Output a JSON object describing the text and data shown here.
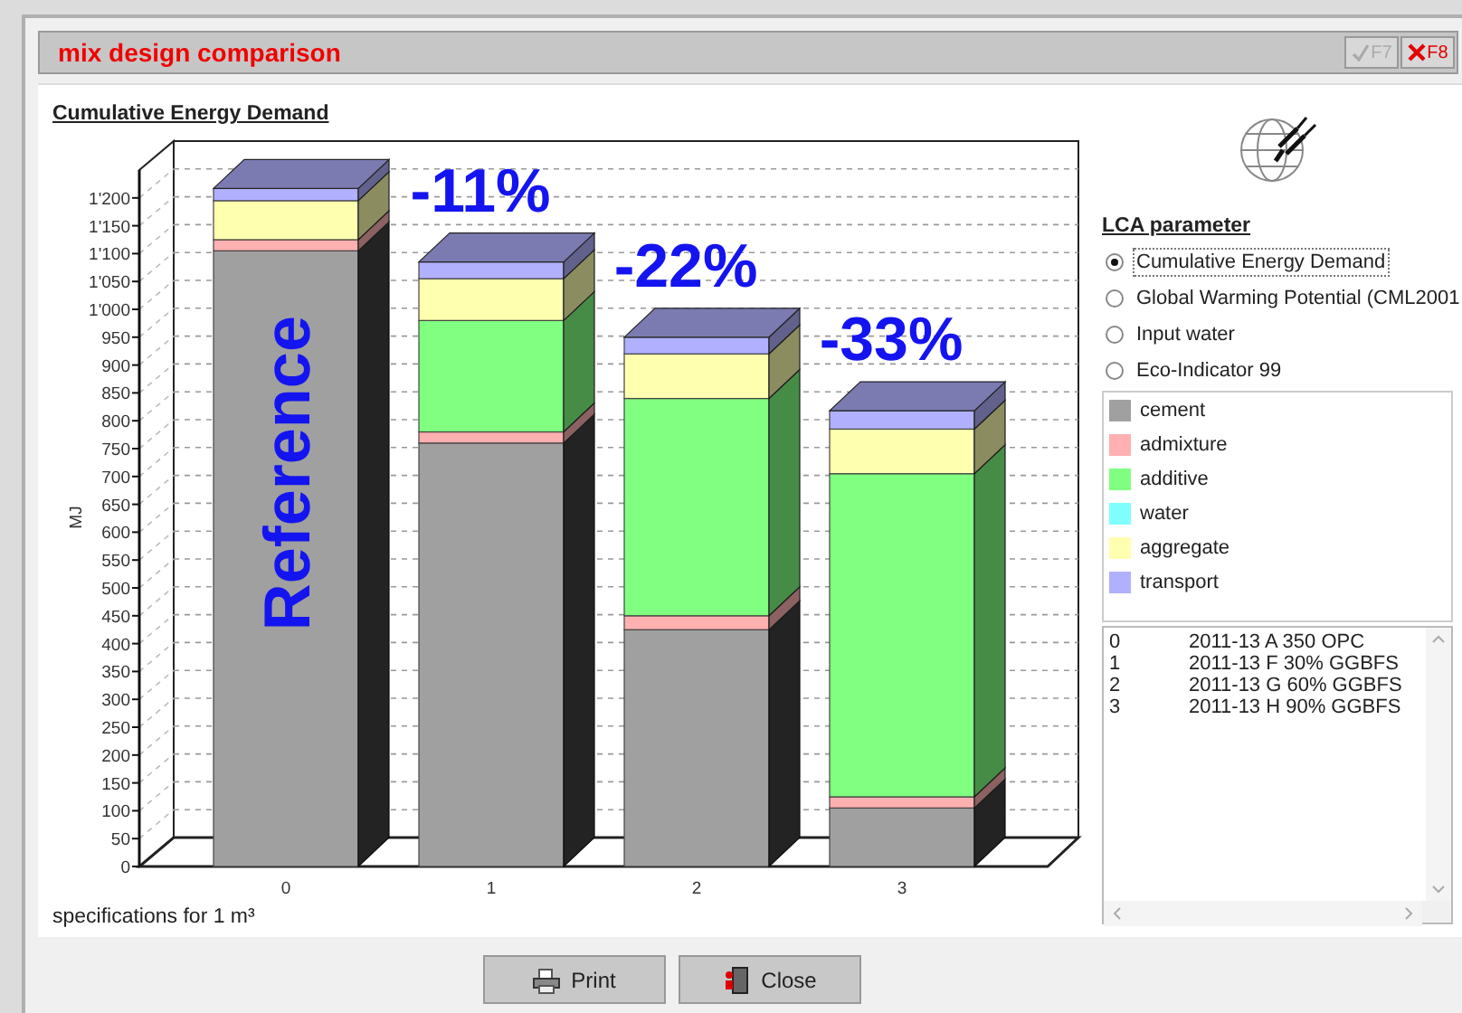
{
  "window": {
    "title": "mix design comparison",
    "title_buttons": [
      {
        "label": "F7",
        "kind": "check",
        "disabled": true
      },
      {
        "label": "F8",
        "kind": "close",
        "disabled": false
      }
    ]
  },
  "chart": {
    "title": "Cumulative Energy Demand",
    "footnote": "specifications for 1 m³",
    "chart_data": {
      "type": "bar",
      "stacked": true,
      "ylabel": "MJ",
      "categories": [
        "0",
        "1",
        "2",
        "3"
      ],
      "series": [
        {
          "name": "cement",
          "color": "#a0a0a0",
          "values": [
            1105,
            760,
            425,
            105
          ]
        },
        {
          "name": "admixture",
          "color": "#ffb0b0",
          "values": [
            20,
            20,
            25,
            20
          ]
        },
        {
          "name": "additive",
          "color": "#80ff80",
          "values": [
            0,
            200,
            390,
            580
          ]
        },
        {
          "name": "water",
          "color": "#80ffff",
          "values": [
            0,
            0,
            0,
            0
          ]
        },
        {
          "name": "aggregate",
          "color": "#ffffb0",
          "values": [
            70,
            75,
            80,
            80
          ]
        },
        {
          "name": "transport",
          "color": "#b0b0ff",
          "values": [
            22,
            30,
            30,
            33
          ]
        }
      ],
      "ylim": [
        0,
        1250
      ],
      "grid": true,
      "yticks": [
        0,
        50,
        100,
        150,
        200,
        250,
        300,
        350,
        400,
        450,
        500,
        550,
        600,
        650,
        700,
        750,
        800,
        850,
        900,
        950,
        {
          "value": 1000,
          "label": "1'000"
        },
        {
          "value": 1050,
          "label": "1'050"
        },
        {
          "value": 1100,
          "label": "1'100"
        },
        {
          "value": 1150,
          "label": "1'150"
        },
        {
          "value": 1200,
          "label": "1'200"
        }
      ],
      "annotations": [
        "Reference",
        "-11%",
        "-22%",
        "-33%"
      ]
    }
  },
  "parameters": {
    "heading": "LCA parameter",
    "options": [
      {
        "label": "Cumulative Energy Demand",
        "selected": true
      },
      {
        "label": "Global Warming Potential (CML2001",
        "selected": false
      },
      {
        "label": "Input water",
        "selected": false
      },
      {
        "label": "Eco-Indicator 99",
        "selected": false
      }
    ]
  },
  "specifications": [
    {
      "index": "0",
      "name": "2011-13 A 350 OPC"
    },
    {
      "index": "1",
      "name": "2011-13 F 30% GGBFS"
    },
    {
      "index": "2",
      "name": "2011-13 G 60% GGBFS"
    },
    {
      "index": "3",
      "name": "2011-13 H 90% GGBFS"
    }
  ],
  "buttons": [
    {
      "label": "Print",
      "kind": "print"
    },
    {
      "label": "Close",
      "kind": "close"
    }
  ]
}
